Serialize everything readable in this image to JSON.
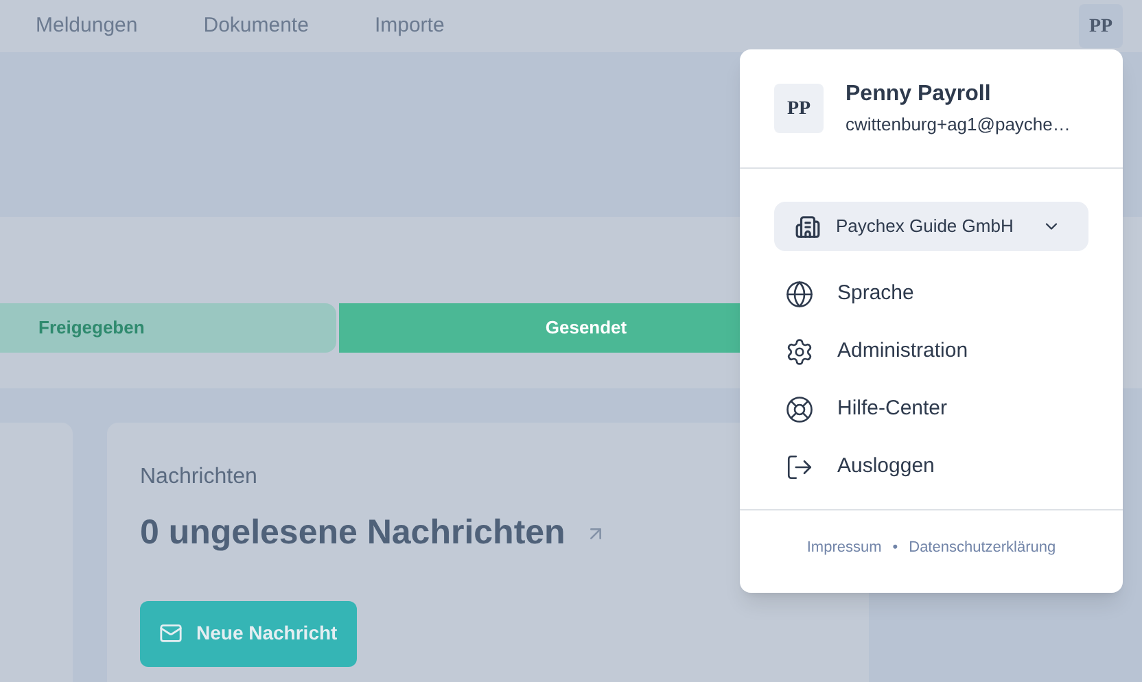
{
  "nav": {
    "items": [
      {
        "label": "Meldungen"
      },
      {
        "label": "Dokumente"
      },
      {
        "label": "Importe"
      }
    ],
    "avatar": "PP"
  },
  "status_steps": [
    {
      "label": "Freigegeben",
      "selected": false
    },
    {
      "label": "Gesendet",
      "selected": true
    }
  ],
  "messages_card": {
    "title": "Nachrichten",
    "headline": "0 ungelesene Nachrichten",
    "button": "Neue Nachricht"
  },
  "user_menu": {
    "avatar": "PP",
    "name": "Penny Payroll",
    "email": "cwittenburg+ag1@payche…",
    "company": "Paychex Guide GmbH",
    "items": [
      {
        "label": "Sprache",
        "kind": "language"
      },
      {
        "label": "Administration",
        "kind": "settings"
      },
      {
        "label": "Hilfe-Center",
        "kind": "help"
      },
      {
        "label": "Ausloggen",
        "kind": "logout"
      }
    ],
    "footer_links": [
      "Impressum",
      "Datenschutzerklärung"
    ],
    "separator": "•"
  }
}
